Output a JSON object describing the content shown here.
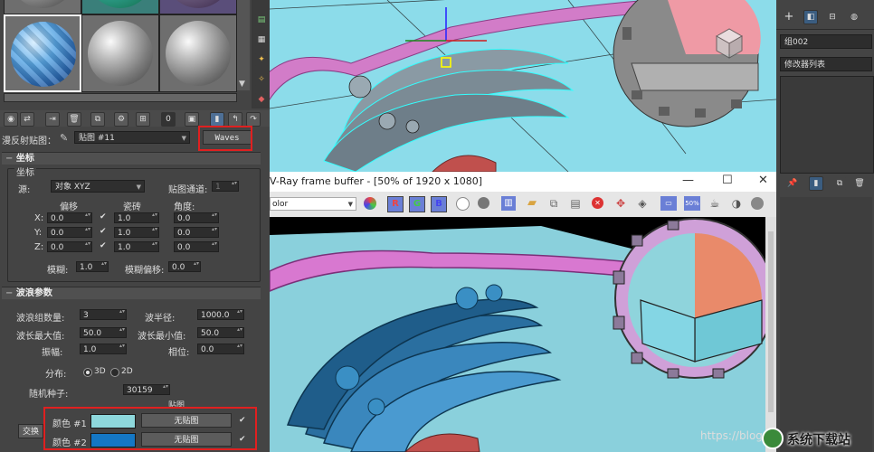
{
  "material_editor": {
    "map_label": "漫反射贴图：",
    "map_dropdown": "贴图 #11",
    "map_type_button": "Waves",
    "coords": {
      "title": "坐标",
      "group_title": "坐标",
      "source_label": "源:",
      "source_value": "对象 XYZ",
      "channel_label": "贴图通道:",
      "channel_value": "1",
      "col_offset": "偏移",
      "col_tiling": "瓷砖",
      "col_angle": "角度:",
      "axes": [
        "X:",
        "Y:",
        "Z:"
      ],
      "offset": [
        "0.0",
        "0.0",
        "0.0"
      ],
      "tiling": [
        "1.0",
        "1.0",
        "1.0"
      ],
      "angle": [
        "0.0",
        "0.0",
        "0.0"
      ],
      "blur_label": "模糊:",
      "blur_value": "1.0",
      "blur_offset_label": "模糊偏移:",
      "blur_offset_value": "0.0"
    },
    "waves": {
      "title": "波浪参数",
      "num_waves_label": "波浪组数量:",
      "num_waves_value": "3",
      "radius_label": "波半径:",
      "radius_value": "1000.0",
      "len_max_label": "波长最大值:",
      "len_max_value": "50.0",
      "len_min_label": "波长最小值:",
      "len_min_value": "50.0",
      "amp_label": "振幅:",
      "amp_value": "1.0",
      "phase_label": "相位:",
      "phase_value": "0.0",
      "dist_label": "分布:",
      "dist_3d": "3D",
      "dist_2d": "2D",
      "seed_label": "随机种子:",
      "seed_value": "30159",
      "maps_header": "贴图",
      "swap_button": "交换",
      "color1_label": "颜色 #1",
      "color1_hex": "#8ed8dc",
      "color1_map": "无贴图",
      "color2_label": "颜色 #2",
      "color2_hex": "#1577c4",
      "color2_map": "无贴图"
    }
  },
  "modify_panel": {
    "object_name": "组002",
    "modifier_list": "修改器列表"
  },
  "vray_window": {
    "title": "V-Ray frame buffer - [50% of 1920 x 1080]",
    "channel_dropdown": "olor",
    "zoom_badge": "50%",
    "btn_r": "R",
    "btn_g": "G",
    "btn_b": "B",
    "minimize": "—",
    "maximize": "☐",
    "close": "✕"
  },
  "watermark": {
    "url_text": "https://blog.c",
    "brand_text": "系统下载站"
  }
}
